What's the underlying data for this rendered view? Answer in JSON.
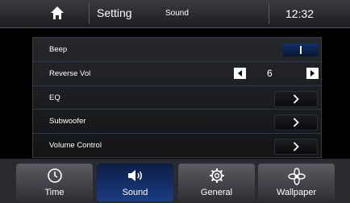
{
  "header": {
    "title": "Setting",
    "section": "Sound",
    "time": "12:32"
  },
  "settings": {
    "beep": {
      "label": "Beep",
      "toggle_symbol": "I"
    },
    "reverse_vol": {
      "label": "Reverse Vol",
      "value": "6"
    },
    "eq": {
      "label": "EQ"
    },
    "subwoofer": {
      "label": "Subwoofer"
    },
    "volume_control": {
      "label": "Volume Control"
    }
  },
  "nav": {
    "time": {
      "label": "Time",
      "icon": "clock-icon"
    },
    "sound": {
      "label": "Sound",
      "icon": "speaker-icon",
      "active": true
    },
    "general": {
      "label": "General",
      "icon": "gear-icon"
    },
    "wallpaper": {
      "label": "Wallpaper",
      "icon": "flower-icon"
    }
  },
  "colors": {
    "accent": "#1b3d83",
    "row_separator": "#2d3a55"
  }
}
